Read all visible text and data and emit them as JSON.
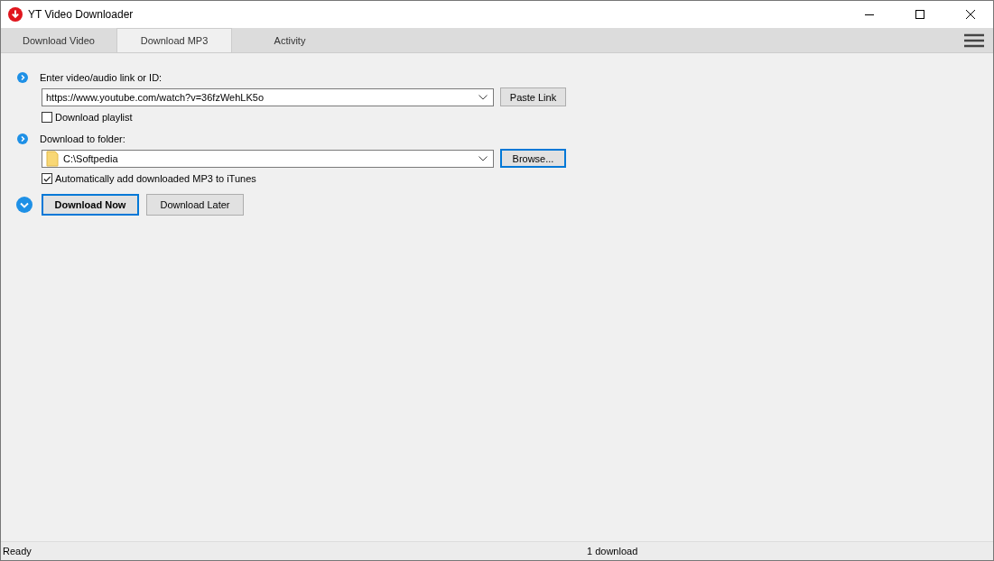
{
  "window": {
    "title": "YT Video Downloader"
  },
  "tabs": [
    {
      "label": "Download Video",
      "selected": false
    },
    {
      "label": "Download MP3",
      "selected": true
    },
    {
      "label": "Activity",
      "selected": false
    }
  ],
  "link_section": {
    "label": "Enter video/audio link or ID:",
    "value": "https://www.youtube.com/watch?v=36fzWehLK5o",
    "button": "Paste Link",
    "playlist": {
      "label": "Download playlist",
      "checked": false
    }
  },
  "folder_section": {
    "label": "Download to folder:",
    "value": "C:\\Softpedia",
    "button": "Browse...",
    "itunes": {
      "label": "Automatically add downloaded MP3 to iTunes",
      "checked": true
    }
  },
  "actions": [
    {
      "label": "Download Now",
      "default": true
    },
    {
      "label": "Download Later",
      "default": false
    }
  ],
  "status_bar": {
    "left": "Ready",
    "center": "1 download"
  }
}
